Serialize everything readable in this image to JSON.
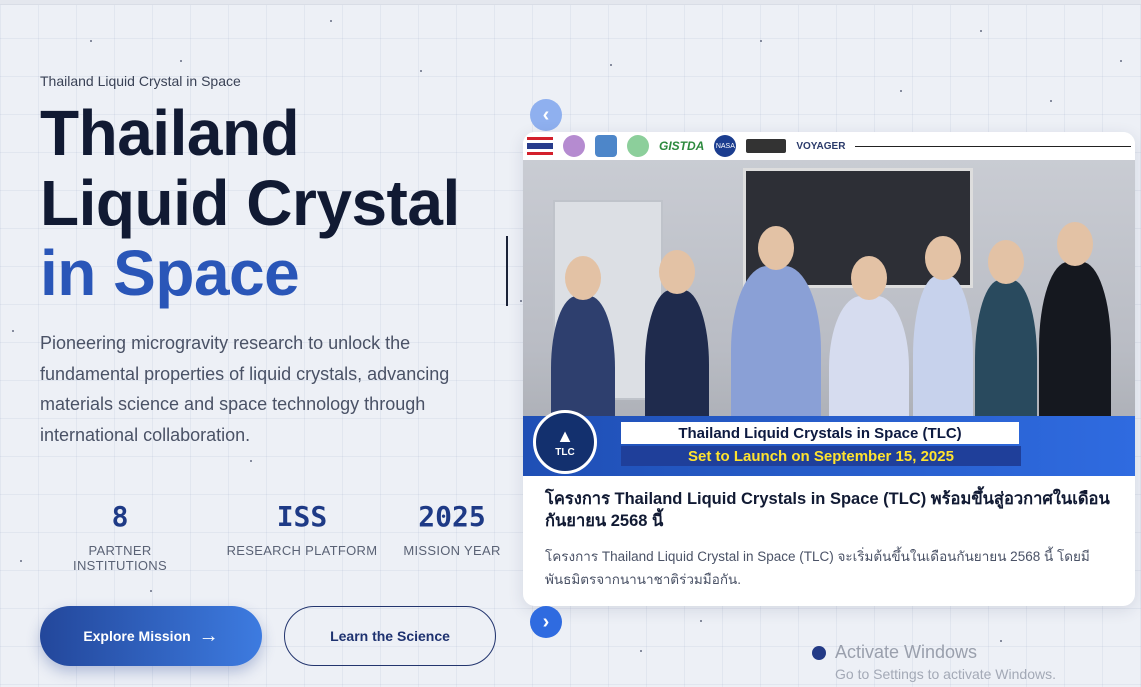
{
  "hero": {
    "eyebrow": "Thailand Liquid Crystal in Space",
    "title_line1": "Thailand",
    "title_line2": "Liquid Crystal",
    "title_line3_accent": "in Space",
    "description": "Pioneering microgravity research to unlock the fundamental properties of liquid crystals, advancing materials science and space technology through international collaboration."
  },
  "stats": [
    {
      "value": "8",
      "label": "PARTNER INSTITUTIONS"
    },
    {
      "value": "ISS",
      "label": "RESEARCH PLATFORM"
    },
    {
      "value": "2025",
      "label": "MISSION YEAR"
    }
  ],
  "buttons": {
    "primary": "Explore Mission",
    "primary_icon": "→",
    "secondary": "Learn the Science"
  },
  "carousel": {
    "prev_icon": "‹",
    "next_icon": "›",
    "logos": [
      "GISTDA",
      "NASA",
      "VOYAGER"
    ],
    "banner_line1": "Thailand Liquid Crystals in Space (TLC)",
    "banner_line2": "Set to Launch on September 15, 2025",
    "emblem_text": "TLC",
    "card_title": "โครงการ Thailand Liquid Crystals in Space (TLC) พร้อมขึ้นสู่อวกาศในเดือนกันยายน 2568 นี้",
    "card_body": "โครงการ Thailand Liquid Crystal in Space (TLC) จะเริ่มต้นขึ้นในเดือนกันยายน 2568 นี้ โดยมีพันธมิตรจากนานาชาติร่วมมือกัน."
  },
  "watermark": {
    "line1": "Activate Windows",
    "line2": "Go to Settings to activate Windows."
  },
  "colors": {
    "accent": "#2a56b8",
    "primary_gradient_start": "#23479b",
    "primary_gradient_end": "#3d7be0",
    "heading": "#111a33"
  }
}
